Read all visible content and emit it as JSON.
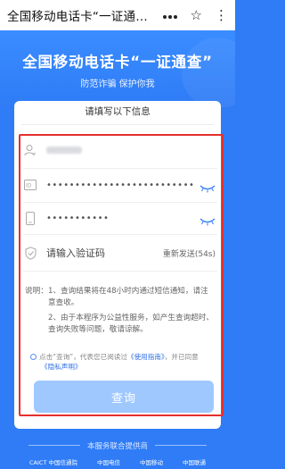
{
  "topbar": {
    "title": "全国移动电话卡“一证通…",
    "icons": [
      "dots-icon",
      "star-icon",
      "more-icon"
    ]
  },
  "banner": {
    "title": "全国移动电话卡“一证通查”",
    "subtitle": "防范诈骗 保护你我"
  },
  "card": {
    "title": "请填写以下信息",
    "fields": {
      "name_icon": "user-icon",
      "id_icon": "id-card-icon",
      "id_value": "••••••••••••••••••••••••••",
      "phone_icon": "phone-icon",
      "phone_value": "•••••••••••"
    },
    "code": {
      "placeholder": "请输入验证码",
      "resend": "重新发送(54s)"
    },
    "notes": {
      "label": "说明：",
      "item1": "1、查询结果将在48小时内通过短信通知，请注意查收。",
      "item2": "2、由于本程序为公益性服务，如产生查询超时、查询失败等问题，敬请谅解。"
    },
    "agree": {
      "prefix": "点击“查询”，代表您已阅读过",
      "guide": "《使用指南》",
      "suffix": "，并已同意",
      "privacy": "《隐私声明》"
    },
    "query_button": "查询"
  },
  "footer": {
    "title": "本服务联合提供商",
    "logos": [
      "CAICT 中国信通院",
      "中国电信",
      "中国移动",
      "中国联通"
    ]
  },
  "colors": {
    "primary": "#2f7cf6",
    "button_disabled": "#9fc8ff",
    "highlight_box": "#e4302e",
    "link": "#2f6fe6"
  }
}
